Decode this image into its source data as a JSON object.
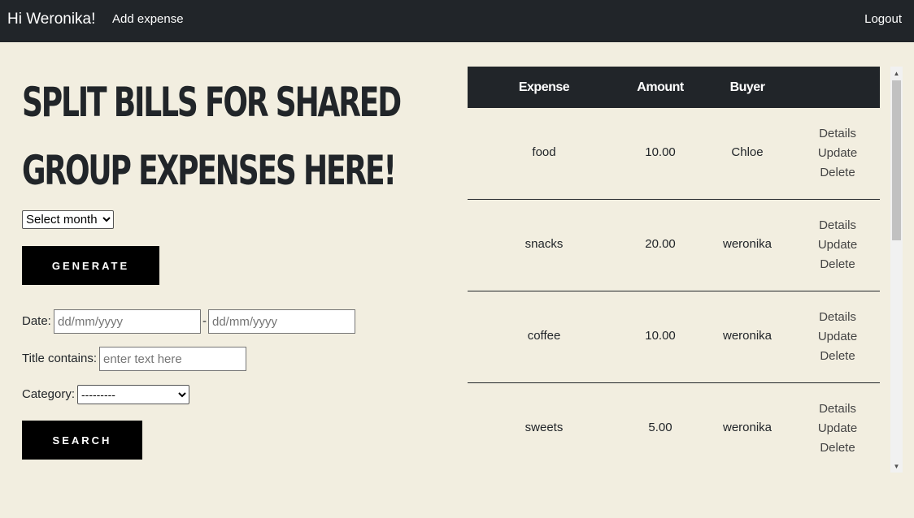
{
  "nav": {
    "greeting": "Hi Weronika!",
    "add_expense": "Add expense",
    "logout": "Logout"
  },
  "headline": "Split bills for shared group expenses here!",
  "generate_form": {
    "month_select": "Select month",
    "generate_label": "GENERATE"
  },
  "search_form": {
    "date_label": "Date:",
    "date_from_placeholder": "dd/mm/yyyy",
    "date_separator": "-",
    "date_to_placeholder": "dd/mm/yyyy",
    "title_label": "Title contains:",
    "title_placeholder": "enter text here",
    "category_label": "Category:",
    "category_selected": "---------",
    "search_label": "SEARCH"
  },
  "table": {
    "headers": [
      "Expense",
      "Amount",
      "Buyer",
      ""
    ],
    "rows": [
      {
        "expense": "food",
        "amount": "10.00",
        "buyer": "Chloe"
      },
      {
        "expense": "snacks",
        "amount": "20.00",
        "buyer": "weronika"
      },
      {
        "expense": "coffee",
        "amount": "10.00",
        "buyer": "weronika"
      },
      {
        "expense": "sweets",
        "amount": "5.00",
        "buyer": "weronika"
      }
    ],
    "actions": {
      "details": "Details",
      "update": "Update",
      "delete": "Delete"
    }
  },
  "colors": {
    "background": "#f2eee0",
    "navbar": "#212529",
    "button": "#000000"
  }
}
